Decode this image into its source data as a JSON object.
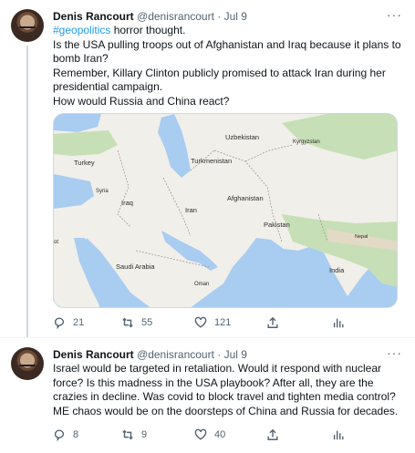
{
  "tweets": [
    {
      "author_name": "Denis Rancourt",
      "handle": "@denisrancourt",
      "separator": "·",
      "date": "Jul 9",
      "more": "···",
      "hashtag": "#geopolitics",
      "lines": [
        " horror thought.",
        "Is the USA pulling troops out of Afghanistan and Iraq because it plans to bomb Iran?",
        "Remember, Killary Clinton publicly promised to attack Iran during her presidential campaign.",
        "How would Russia and China react?"
      ],
      "map_labels": {
        "uzbekistan": "Uzbekistan",
        "kyrgyzstan": "Kyrgyzstan",
        "turkey": "Turkey",
        "turkmenistan": "Turkmenistan",
        "syria": "Syria",
        "iraq": "Iraq",
        "afghanistan": "Afghanistan",
        "iran": "Iran",
        "pakistan": "Pakistan",
        "nepal": "Nepal",
        "saudi_arabia": "Saudi Arabia",
        "oman": "Oman",
        "india": "India",
        "edge_ot": "ot"
      },
      "counts": {
        "replies": "21",
        "retweets": "55",
        "likes": "121"
      }
    },
    {
      "author_name": "Denis Rancourt",
      "handle": "@denisrancourt",
      "separator": "·",
      "date": "Jul 9",
      "more": "···",
      "text": "Israel would be targeted in retaliation. Would it respond with nuclear force? Is this madness in the USA playbook? After all, they are the crazies in decline. Was covid to block travel and tighten media control? ME chaos would be on the doorsteps of China and Russia for decades.",
      "counts": {
        "replies": "8",
        "retweets": "9",
        "likes": "40"
      }
    }
  ],
  "colors": {
    "link": "#1d9bf0",
    "secondary_text": "#536471",
    "water": "#a9ccf1",
    "land": "#f1efe9",
    "green": "#c6dfb6"
  },
  "icons": [
    "more-icon",
    "reply-icon",
    "retweet-icon",
    "like-icon",
    "share-icon",
    "analytics-icon"
  ]
}
